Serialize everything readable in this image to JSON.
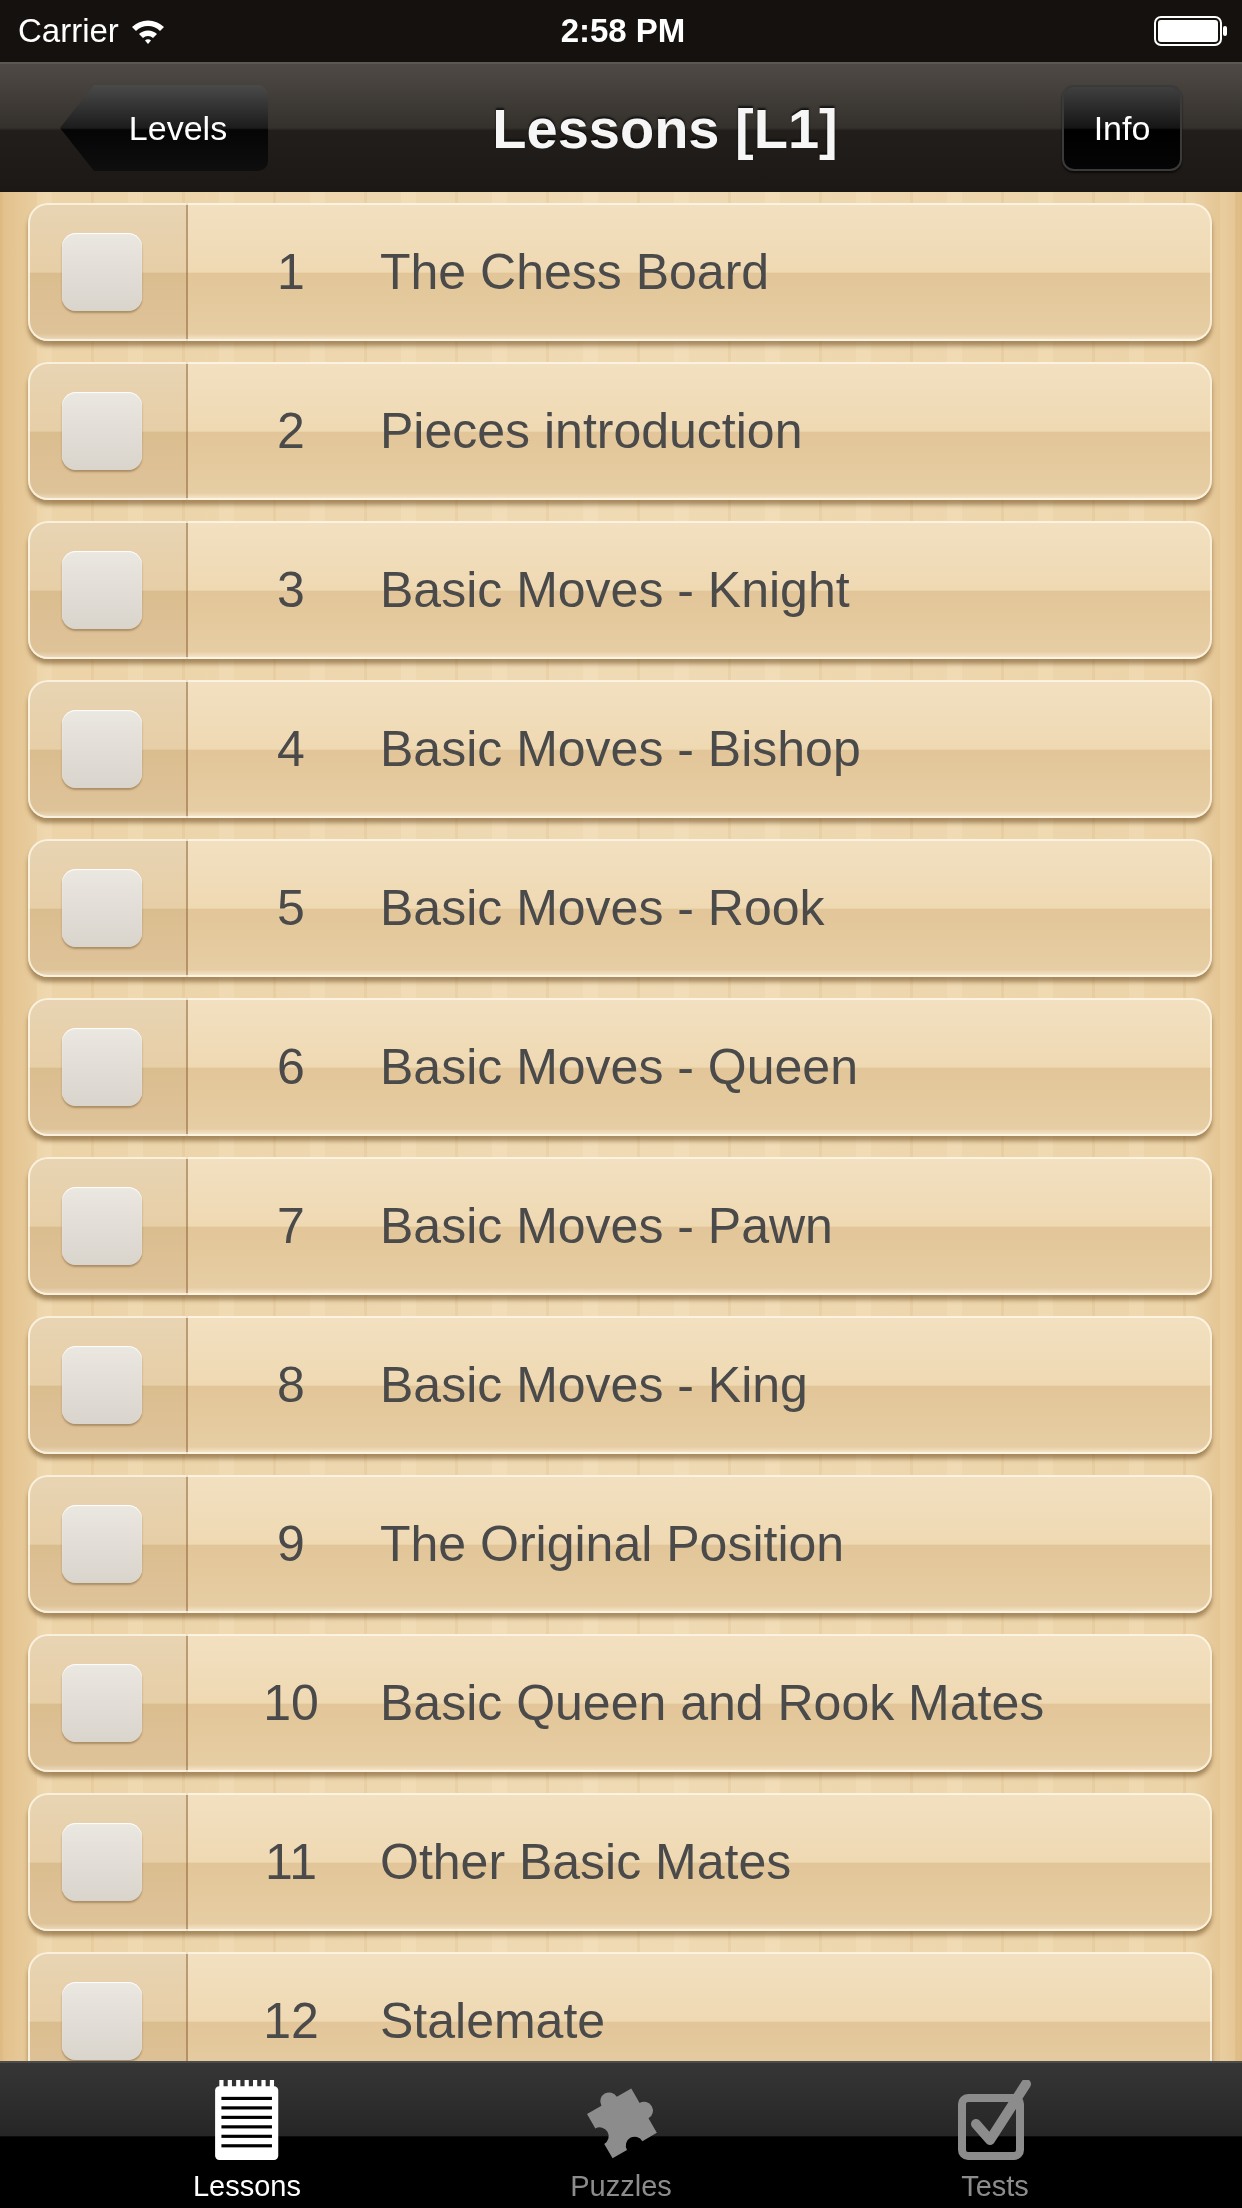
{
  "status_bar": {
    "carrier": "Carrier",
    "time": "2:58 PM"
  },
  "nav_bar": {
    "back_button": "Levels",
    "title": "Lessons [L1]",
    "info_button": "Info"
  },
  "lessons": [
    {
      "number": "1",
      "title": "The Chess Board",
      "checked": false
    },
    {
      "number": "2",
      "title": "Pieces introduction",
      "checked": false
    },
    {
      "number": "3",
      "title": "Basic Moves - Knight",
      "checked": false
    },
    {
      "number": "4",
      "title": "Basic Moves - Bishop",
      "checked": false
    },
    {
      "number": "5",
      "title": "Basic Moves - Rook",
      "checked": false
    },
    {
      "number": "6",
      "title": "Basic Moves - Queen",
      "checked": false
    },
    {
      "number": "7",
      "title": "Basic Moves - Pawn",
      "checked": false
    },
    {
      "number": "8",
      "title": "Basic Moves - King",
      "checked": false
    },
    {
      "number": "9",
      "title": "The Original Position",
      "checked": false
    },
    {
      "number": "10",
      "title": "Basic Queen and Rook Mates",
      "checked": false
    },
    {
      "number": "11",
      "title": "Other Basic Mates",
      "checked": false
    },
    {
      "number": "12",
      "title": "Stalemate",
      "checked": false
    }
  ],
  "tab_bar": [
    {
      "label": "Lessons",
      "kind": "notepad",
      "selected": true
    },
    {
      "label": "Puzzles",
      "kind": "puzzle",
      "selected": false
    },
    {
      "label": "Tests",
      "kind": "checkbox",
      "selected": false
    }
  ]
}
